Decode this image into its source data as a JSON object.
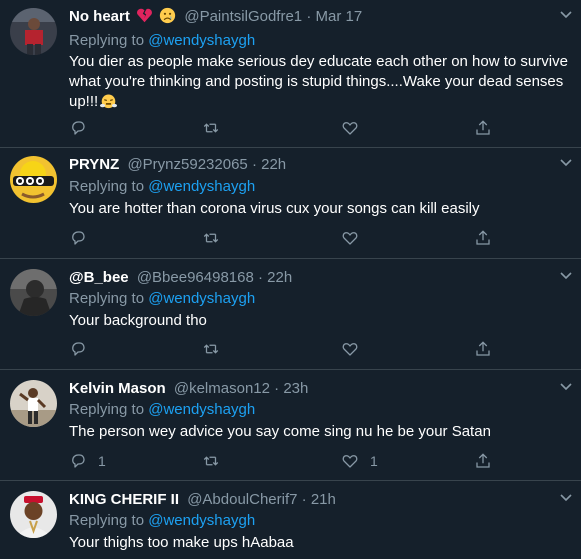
{
  "tweets": [
    {
      "display_name": "No heart",
      "name_emojis": [
        "broken-heart",
        "crying-face"
      ],
      "handle": "@PaintsilGodfre1",
      "separator": "·",
      "time": "Mar 17",
      "replying_prefix": "Replying to",
      "replying_to": "@wendyshaygh",
      "text_lines": [
        "You dier as people make serious dey educate each other on how to survive",
        "what you're thinking and posting is stupid things....Wake your dead senses",
        "up!!!"
      ],
      "trailing_emoji": "steam-face",
      "reply_count": "",
      "retweet_count": "",
      "like_count": ""
    },
    {
      "display_name": "PRYNZ",
      "handle": "@Prynz59232065",
      "separator": "·",
      "time": "22h",
      "replying_prefix": "Replying to",
      "replying_to": "@wendyshaygh",
      "text_lines": [
        "You are hotter than corona virus cux your songs can kill easily"
      ],
      "reply_count": "",
      "retweet_count": "",
      "like_count": ""
    },
    {
      "display_name": "@B_bee",
      "handle": "@Bbee96498168",
      "separator": "·",
      "time": "22h",
      "replying_prefix": "Replying to",
      "replying_to": "@wendyshaygh",
      "text_lines": [
        "Your background tho"
      ],
      "reply_count": "",
      "retweet_count": "",
      "like_count": ""
    },
    {
      "display_name": "Kelvin Mason",
      "handle": "@kelmason12",
      "separator": "·",
      "time": "23h",
      "replying_prefix": "Replying to",
      "replying_to": "@wendyshaygh",
      "text_lines": [
        "The person wey advice you say come sing nu he be your Satan"
      ],
      "reply_count": "1",
      "retweet_count": "",
      "like_count": "1"
    },
    {
      "display_name": "KING CHERIF II",
      "handle": "@AbdoulCherif7",
      "separator": "·",
      "time": "21h",
      "replying_prefix": "Replying to",
      "replying_to": "@wendyshaygh",
      "text_lines": [
        "Your thighs too make ups hAabaa"
      ],
      "reply_count": "",
      "retweet_count": "",
      "like_count": ""
    }
  ],
  "colors": {
    "background": "#15202b",
    "divider": "#38444d",
    "primary_text": "#ffffff",
    "secondary_text": "#8899a6",
    "accent": "#1da1f2"
  },
  "icons": {
    "reply": "reply-icon",
    "retweet": "retweet-icon",
    "like": "heart-icon",
    "share": "share-icon",
    "more": "chevron-down-icon"
  }
}
